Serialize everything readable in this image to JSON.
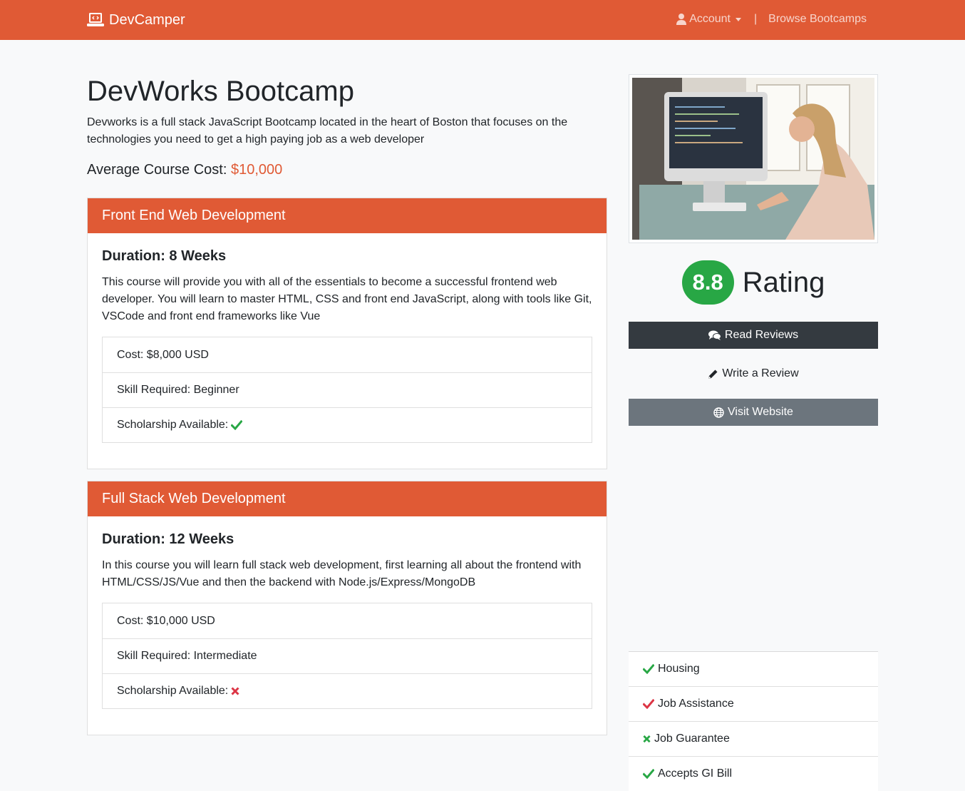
{
  "navbar": {
    "brand": "DevCamper",
    "account_label": "Account",
    "separator": "|",
    "browse_label": "Browse Bootcamps"
  },
  "bootcamp": {
    "name": "DevWorks Bootcamp",
    "description": "Devworks is a full stack JavaScript Bootcamp located in the heart of Boston that focuses on the technologies you need to get a high paying job as a web developer",
    "avg_cost_label": "Average Course Cost:",
    "avg_cost_value": "$10,000"
  },
  "courses": [
    {
      "title": "Front End Web Development",
      "duration": "Duration: 8 Weeks",
      "description": "This course will provide you with all of the essentials to become a successful frontend web developer. You will learn to master HTML, CSS and front end JavaScript, along with tools like Git, VSCode and front end frameworks like Vue",
      "cost": "Cost: $8,000 USD",
      "skill": "Skill Required: Beginner",
      "scholarship_label": "Scholarship Available:",
      "scholarship_icon": "check-icon",
      "scholarship_color": "#28a745"
    },
    {
      "title": "Full Stack Web Development",
      "duration": "Duration: 12 Weeks",
      "description": "In this course you will learn full stack web development, first learning all about the frontend with HTML/CSS/JS/Vue and then the backend with Node.js/Express/MongoDB",
      "cost": "Cost: $10,000 USD",
      "skill": "Skill Required: Intermediate",
      "scholarship_label": "Scholarship Available:",
      "scholarship_icon": "times-icon",
      "scholarship_color": "#dc3545"
    }
  ],
  "sidebar": {
    "rating_value": "8.8",
    "rating_label": "Rating",
    "read_reviews": "Read Reviews",
    "write_review": "Write a Review",
    "visit_website": "Visit Website",
    "features": [
      {
        "label": "Housing",
        "icon": "check-icon",
        "color": "#28a745"
      },
      {
        "label": "Job Assistance",
        "icon": "check-icon",
        "color": "#dc3545"
      },
      {
        "label": "Job Guarantee",
        "icon": "times-icon",
        "color": "#28a745"
      },
      {
        "label": "Accepts GI Bill",
        "icon": "check-icon",
        "color": "#28a745"
      }
    ]
  },
  "colors": {
    "brand": "#e05a35",
    "success": "#28a745",
    "danger": "#dc3545",
    "dark": "#343a40",
    "secondary": "#6c757d"
  }
}
